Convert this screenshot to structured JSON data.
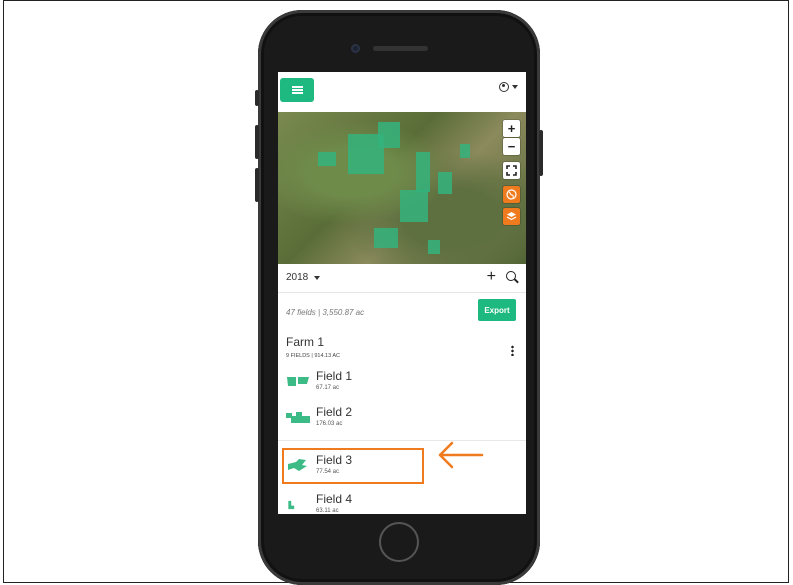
{
  "topbar": {
    "menu_icon": "hamburger-menu-icon",
    "user_icon": "user-circle-icon"
  },
  "map": {
    "zoom_in_label": "+",
    "zoom_out_label": "−",
    "fullscreen_icon": "fullscreen-icon",
    "globe_icon": "globe-icon",
    "layers_icon": "layers-icon"
  },
  "toolbar": {
    "year": "2018",
    "add_label": "+",
    "search_icon": "search-icon"
  },
  "summary": {
    "text": "47 fields | 3,550.87 ac",
    "export_label": "Export"
  },
  "farm": {
    "name": "Farm 1",
    "meta": "9 FIELDS | 914.13 AC"
  },
  "fields": [
    {
      "name": "Field 1",
      "acres": "67.17 ac"
    },
    {
      "name": "Field 2",
      "acres": "176.03 ac"
    },
    {
      "name": "Field 3",
      "acres": "77.54 ac"
    },
    {
      "name": "Field 4",
      "acres": "63.11 ac"
    }
  ],
  "colors": {
    "accent": "#1db980",
    "highlight": "#f07b1e",
    "field_shape": "#3dbb86"
  }
}
